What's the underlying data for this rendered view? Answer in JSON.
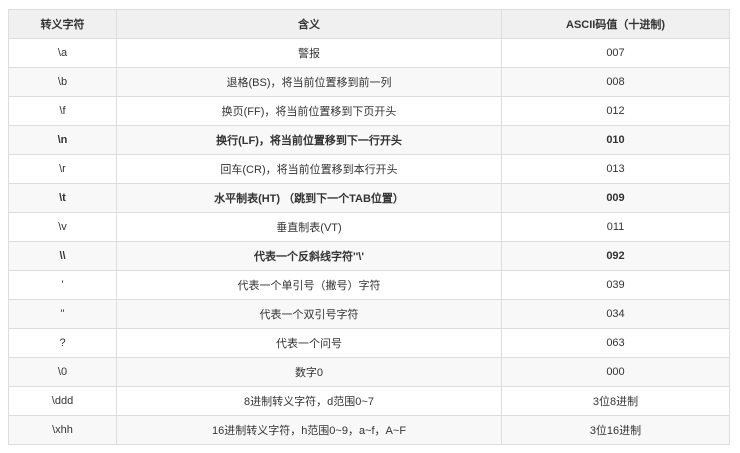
{
  "table": {
    "headers": [
      "转义字符",
      "含义",
      "ASCII码值（十进制)"
    ],
    "rows": [
      {
        "esc": "\\a",
        "meaning": "警报",
        "code": "007",
        "bold": false
      },
      {
        "esc": "\\b",
        "meaning": "退格(BS)，将当前位置移到前一列",
        "code": "008",
        "bold": false
      },
      {
        "esc": "\\f",
        "meaning": "换页(FF)，将当前位置移到下页开头",
        "code": "012",
        "bold": false
      },
      {
        "esc": "\\n",
        "meaning": "换行(LF)，将当前位置移到下一行开头",
        "code": "010",
        "bold": true
      },
      {
        "esc": "\\r",
        "meaning": "回车(CR)，将当前位置移到本行开头",
        "code": "013",
        "bold": false
      },
      {
        "esc": "\\t",
        "meaning": "水平制表(HT) （跳到下一个TAB位置）",
        "code": "009",
        "bold": true
      },
      {
        "esc": "\\v",
        "meaning": "垂直制表(VT)",
        "code": "011",
        "bold": false
      },
      {
        "esc": "\\\\",
        "meaning": "代表一个反斜线字符''\\'",
        "code": "092",
        "bold": true
      },
      {
        "esc": "'",
        "meaning": "代表一个单引号（撇号）字符",
        "code": "039",
        "bold": false
      },
      {
        "esc": "\"",
        "meaning": "代表一个双引号字符",
        "code": "034",
        "bold": false
      },
      {
        "esc": "?",
        "meaning": "代表一个问号",
        "code": "063",
        "bold": false
      },
      {
        "esc": "\\0",
        "meaning": "数字0",
        "code": "000",
        "bold": false
      },
      {
        "esc": "\\ddd",
        "meaning": "8进制转义字符，d范围0~7",
        "code": "3位8进制",
        "bold": false
      },
      {
        "esc": "\\xhh",
        "meaning": "16进制转义字符，h范围0~9，a~f，A~F",
        "code": "3位16进制",
        "bold": false
      }
    ]
  }
}
